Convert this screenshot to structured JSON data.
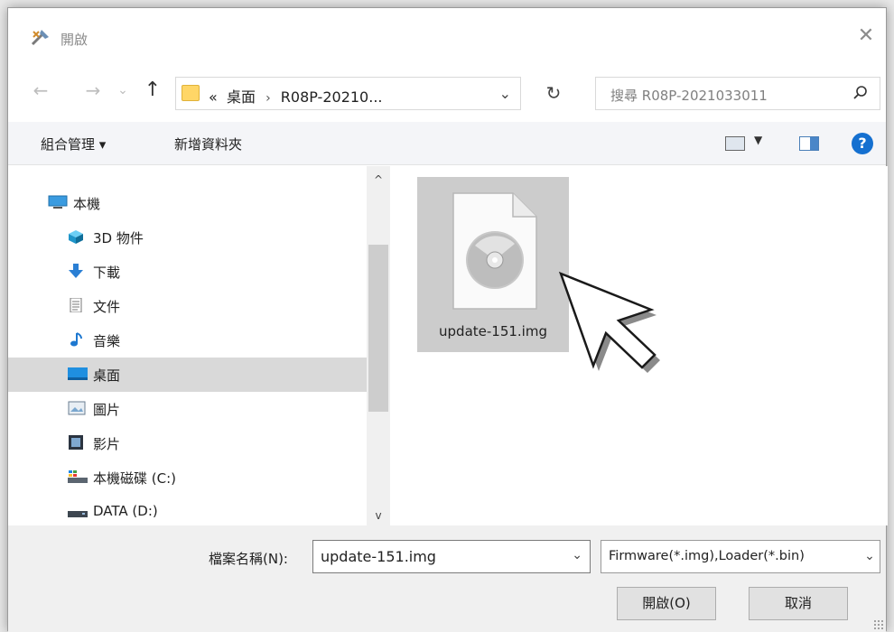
{
  "window": {
    "title": "開啟",
    "close_glyph": "✕"
  },
  "navigation": {
    "back_glyph": "←",
    "forward_glyph": "→",
    "recent_glyph": "⌄",
    "up_glyph": "↑",
    "address": {
      "overflow": "«",
      "segment1": "桌面",
      "separator": "›",
      "segment2": "R08P-20210...",
      "dropdown": "⌄"
    },
    "refresh_glyph": "↻",
    "search_placeholder": "搜尋 R08P-2021033011"
  },
  "commands": {
    "organize": "組合管理 ▾",
    "new_folder": "新增資料夾",
    "view_dropdown": "▼",
    "help": "?"
  },
  "tree": [
    {
      "label": "本機",
      "icon": "computer-icon"
    },
    {
      "label": "3D 物件",
      "icon": "3d-objects-icon"
    },
    {
      "label": "下載",
      "icon": "download-icon"
    },
    {
      "label": "文件",
      "icon": "document-icon"
    },
    {
      "label": "音樂",
      "icon": "music-icon"
    },
    {
      "label": "桌面",
      "icon": "desktop-icon",
      "selected": true
    },
    {
      "label": "圖片",
      "icon": "pictures-icon"
    },
    {
      "label": "影片",
      "icon": "video-icon"
    },
    {
      "label": "本機磁碟 (C:)",
      "icon": "drive-c-icon"
    },
    {
      "label": "DATA (D:)",
      "icon": "drive-d-icon"
    }
  ],
  "scroll": {
    "up": "^",
    "down": "v"
  },
  "files": [
    {
      "name": "update-151.img",
      "icon": "disc-image-icon",
      "selected": true
    }
  ],
  "footer": {
    "filename_label": "檔案名稱(N):",
    "filename_value": "update-151.img",
    "filename_dropdown": "⌄",
    "filter_value": "Firmware(*.img),Loader(*.bin)",
    "filter_dropdown": "⌄",
    "open_button": "開啟(O)",
    "cancel_button": "取消"
  },
  "colors": {
    "selection": "#cccccc",
    "help_blue": "#1570d0",
    "folder_yellow": "#ffd667"
  }
}
